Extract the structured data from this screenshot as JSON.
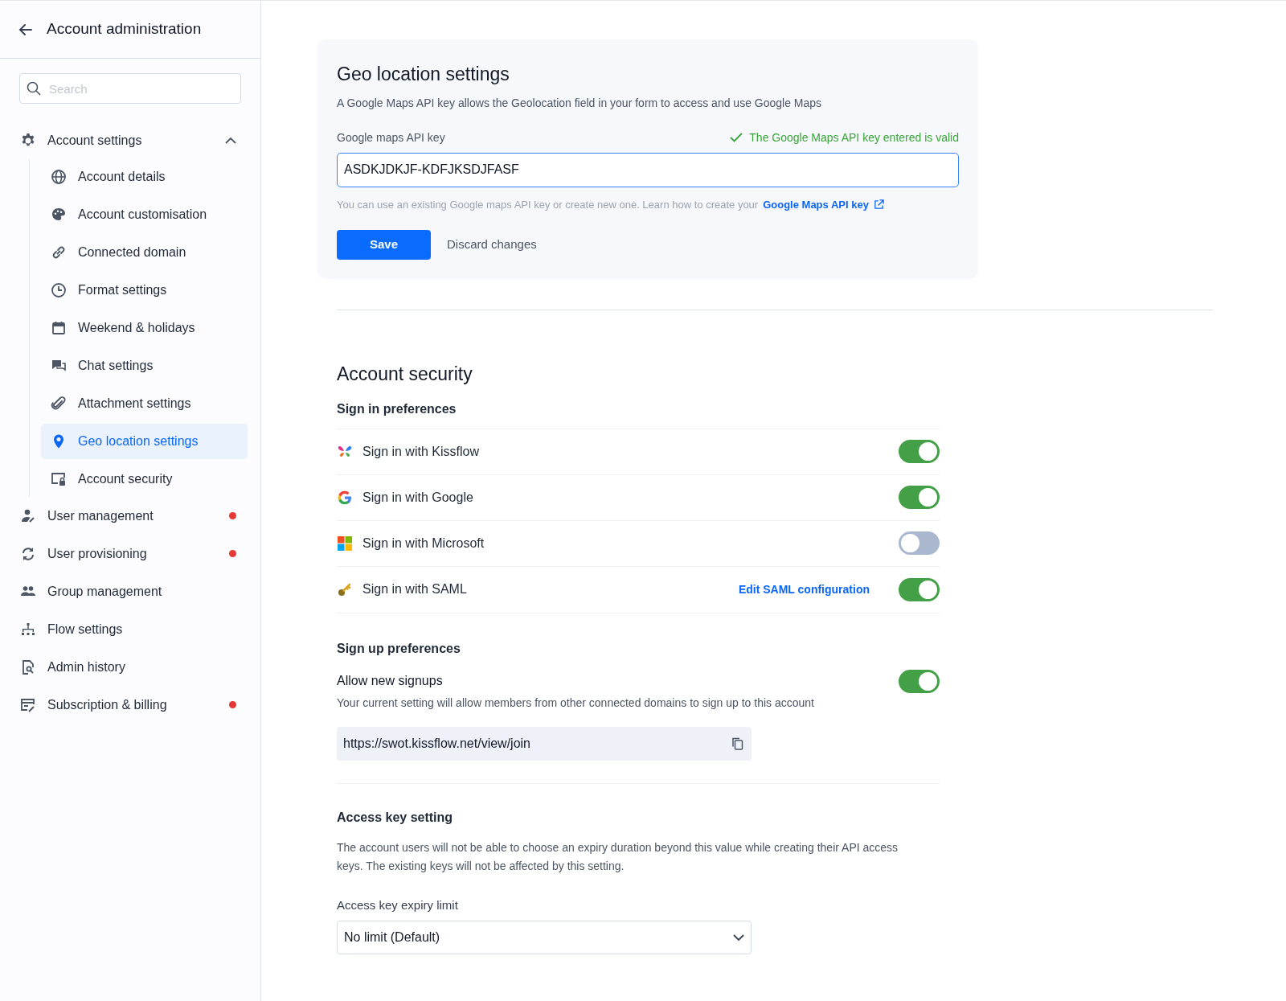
{
  "sidebar": {
    "title": "Account administration",
    "search": {
      "placeholder": "Search"
    },
    "items": [
      {
        "label": "Account settings",
        "expanded": true,
        "notification": false,
        "children": [
          {
            "label": "Account details",
            "selected": false
          },
          {
            "label": "Account customisation",
            "selected": false
          },
          {
            "label": "Connected domain",
            "selected": false
          },
          {
            "label": "Format settings",
            "selected": false
          },
          {
            "label": "Weekend & holidays",
            "selected": false
          },
          {
            "label": "Chat settings",
            "selected": false
          },
          {
            "label": "Attachment settings",
            "selected": false
          },
          {
            "label": "Geo location settings",
            "selected": true
          },
          {
            "label": "Account security",
            "selected": false
          }
        ]
      },
      {
        "label": "User management",
        "notification": true
      },
      {
        "label": "User provisioning",
        "notification": true
      },
      {
        "label": "Group management",
        "notification": false
      },
      {
        "label": "Flow settings",
        "notification": false
      },
      {
        "label": "Admin history",
        "notification": false
      },
      {
        "label": "Subscription & billing",
        "notification": true
      }
    ]
  },
  "geo": {
    "title": "Geo location settings",
    "description": "A Google Maps API key allows the Geolocation field in your form to access and use Google Maps",
    "field_label": "Google maps API key",
    "validation": "The Google Maps API key entered is valid",
    "value": "ASDKJDKJF-KDFJKSDJFASF",
    "help": "You can use an existing Google maps API key or create new one. Learn how to create your",
    "help_link": "Google Maps API key",
    "save": "Save",
    "discard": "Discard changes"
  },
  "security": {
    "title": "Account security",
    "signin_title": "Sign in preferences",
    "signin": [
      {
        "label": "Sign in with Kissflow",
        "on": true
      },
      {
        "label": "Sign in with Google",
        "on": true
      },
      {
        "label": "Sign in with Microsoft",
        "on": false
      },
      {
        "label": "Sign in with SAML",
        "on": true,
        "link": "Edit SAML configuration"
      }
    ],
    "signup_title": "Sign up preferences",
    "signup_label": "Allow new signups",
    "signup_on": true,
    "signup_note": "Your current setting will allow members from other connected domains to sign up to this account",
    "join_url": "https://swot.kissflow.net/view/join",
    "access_title": "Access key setting",
    "access_note": "The account users will not be able to choose an expiry duration beyond this value while creating their API access keys. The existing keys will not be affected by this setting.",
    "expiry_label": "Access key expiry limit",
    "expiry_value": "No limit (Default)"
  }
}
